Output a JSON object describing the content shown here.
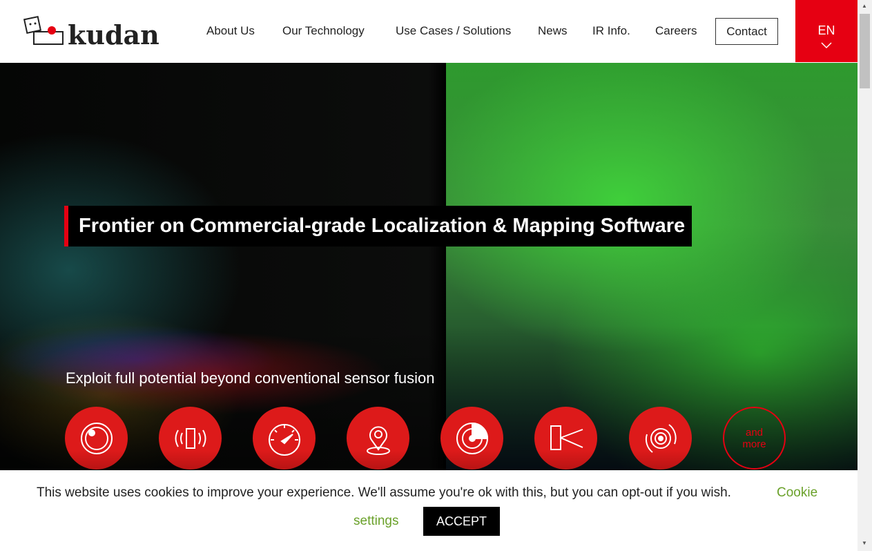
{
  "header": {
    "logo_text": "kudan",
    "nav": [
      "About Us",
      "Our Technology",
      "Use Cases / Solutions",
      "News",
      "IR Info.",
      "Careers"
    ],
    "contact": "Contact",
    "language": "EN"
  },
  "hero": {
    "title": "Frontier on Commercial-grade Localization & Mapping Software",
    "subtitle": "Exploit full potential beyond conventional sensor fusion",
    "features": [
      "camera-icon",
      "vibration-phone-icon",
      "speedometer-icon",
      "location-pin-icon",
      "radar-icon",
      "lidar-icon",
      "wheel-icon"
    ],
    "more": [
      "and",
      "more"
    ]
  },
  "cookie": {
    "text": "This website uses cookies to improve your experience. We'll assume you're ok with this, but you can opt-out if you wish.",
    "settings_1": "Cookie",
    "settings_2": "settings",
    "accept": "ACCEPT"
  },
  "colors": {
    "brand": "#e60012",
    "link": "#6aa12a"
  }
}
